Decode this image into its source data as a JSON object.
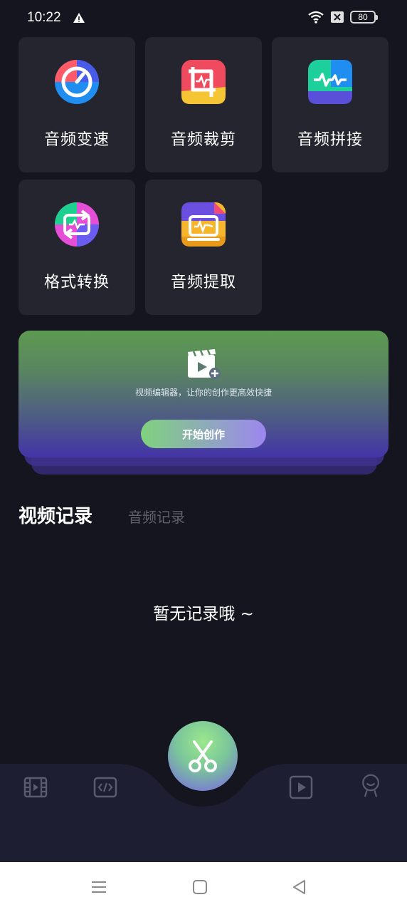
{
  "status_bar": {
    "time": "10:22",
    "battery": "80"
  },
  "tools": [
    {
      "label": "音频变速",
      "icon": "speed-dial-icon"
    },
    {
      "label": "音频裁剪",
      "icon": "audio-crop-icon"
    },
    {
      "label": "音频拼接",
      "icon": "audio-join-icon"
    },
    {
      "label": "格式转换",
      "icon": "format-convert-icon"
    },
    {
      "label": "音频提取",
      "icon": "audio-extract-icon"
    }
  ],
  "banner": {
    "icon": "video-add-icon",
    "description": "视频编辑器，让你的创作更高效快捷",
    "button_label": "开始创作"
  },
  "tabs": {
    "video": "视频记录",
    "audio": "音频记录"
  },
  "empty_state": "暂无记录哦 ~",
  "bottom_nav": {
    "items": [
      "film-icon",
      "code-icon",
      "scissors-icon",
      "play-icon",
      "profile-icon"
    ]
  },
  "colors": {
    "background": "#15151f",
    "card": "#25252f",
    "nav": "#1d1e31",
    "accent_green": "#7fd27d",
    "accent_purple": "#7b61e8"
  }
}
